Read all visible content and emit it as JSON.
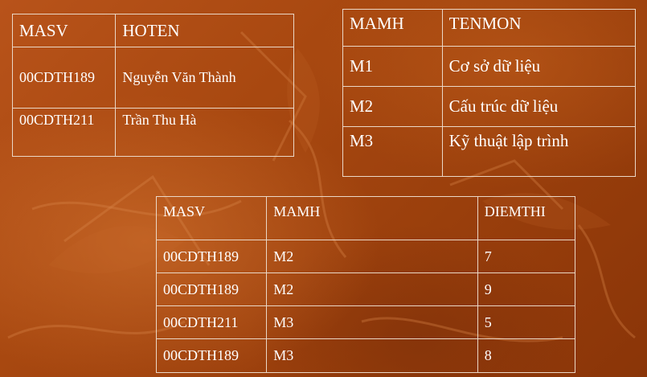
{
  "sinhvien": {
    "headers": [
      "MASV",
      "HOTEN"
    ],
    "rows": [
      [
        "00CDTH189",
        "Nguyễn Văn Thành"
      ],
      [
        "00CDTH211",
        "Trần Thu Hà"
      ]
    ]
  },
  "monhoc": {
    "headers": [
      "MAMH",
      "TENMON"
    ],
    "rows": [
      [
        "M1",
        "Cơ sở dữ liệu"
      ],
      [
        "M2",
        "Cấu trúc dữ liệu"
      ],
      [
        "M3",
        "Kỹ thuật lập trình"
      ]
    ]
  },
  "ketqua": {
    "headers": [
      "MASV",
      "MAMH",
      "DIEMTHI"
    ],
    "rows": [
      [
        "00CDTH189",
        "M2",
        "7"
      ],
      [
        "00CDTH189",
        "M2",
        "9"
      ],
      [
        "00CDTH211",
        "M3",
        "5"
      ],
      [
        "00CDTH189",
        "M3",
        "8"
      ]
    ]
  },
  "colors": {
    "background": "#a84810",
    "text": "#ffffff",
    "border": "#ead7c6"
  }
}
